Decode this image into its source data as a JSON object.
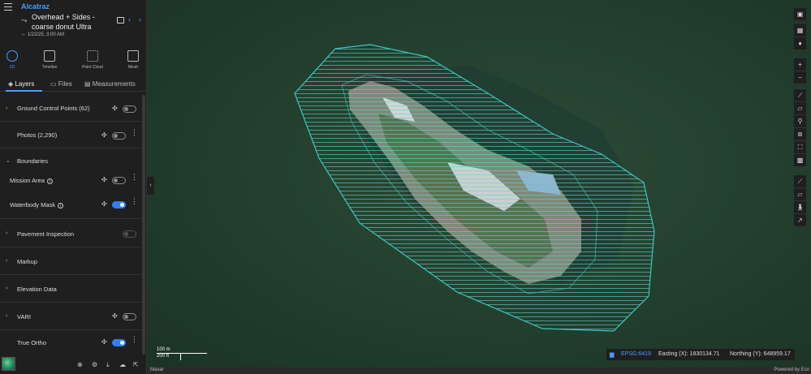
{
  "header": {
    "project": "Alcatraz",
    "mission_title": "Overhead + Sides - coarse donut Ultra",
    "date": "1/22/25, 3:00 AM",
    "icons": [
      "menu-icon",
      "mission-icon",
      "save-icon",
      "chevron-left-icon",
      "chevron-right-icon"
    ]
  },
  "modes": [
    {
      "label": "2D",
      "active": true
    },
    {
      "label": "Timeline"
    },
    {
      "label": "Point Cloud"
    },
    {
      "label": "Mesh"
    }
  ],
  "tabs": [
    {
      "label": "Layers",
      "active": true
    },
    {
      "label": "Files"
    },
    {
      "label": "Measurements"
    }
  ],
  "layers": [
    {
      "label": "Ground Control Points (62)",
      "expandable": true,
      "visible": false
    },
    {
      "label": "Photos (2,290)",
      "expandable": false,
      "visible": false
    },
    {
      "label": "Boundaries",
      "expandable": true,
      "expanded": true
    },
    {
      "label": "Mission Area",
      "info": true,
      "visible": false
    },
    {
      "label": "Waterbody Mask",
      "info": true,
      "visible": true
    },
    {
      "label": "Pavement Inspection",
      "expandable": true,
      "visible": false
    },
    {
      "label": "Markup",
      "expandable": true
    },
    {
      "label": "Elevation Data",
      "expandable": true
    },
    {
      "label": "VARI",
      "expandable": true,
      "visible": false
    },
    {
      "label": "True Ortho",
      "expandable": false,
      "visible": true
    }
  ],
  "map": {
    "scale_metric": "100 m",
    "scale_imperial": "200 ft",
    "epsg": "EPSG:6419",
    "easting": "Easting (X): 1830134.71",
    "northing": "Northing (Y): 648959.17",
    "attribution_left": "Maxar",
    "attribution_right": "Powered by Esri",
    "boundary_color": "#3cc6c0"
  }
}
